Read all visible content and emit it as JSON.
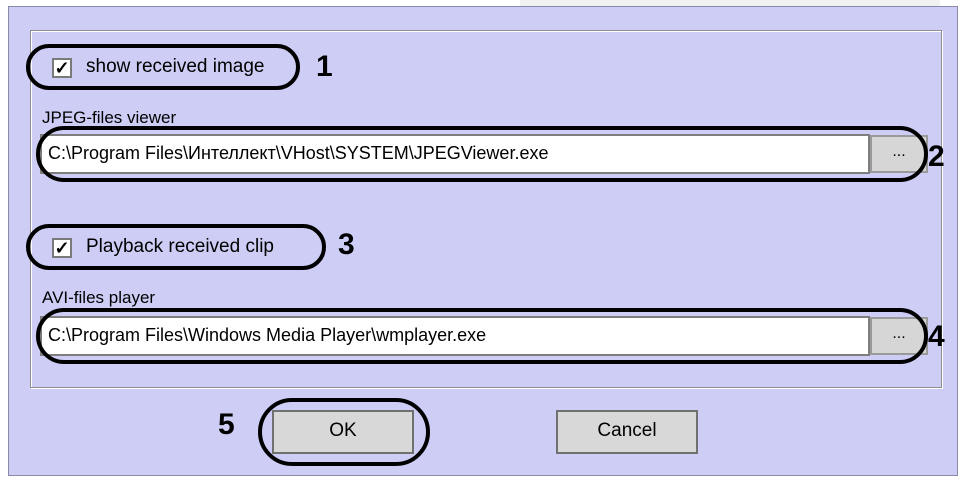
{
  "dialog": {
    "show_image": {
      "label": "show received image",
      "checked": true,
      "checkmark": "☑"
    },
    "jpeg_viewer": {
      "label": "JPEG-files viewer",
      "path": "C:\\Program Files\\Интеллект\\VHost\\SYSTEM\\JPEGViewer.exe",
      "browse_label": "..."
    },
    "playback_clip": {
      "label": "Playback received clip",
      "checked": true,
      "checkmark": "☑"
    },
    "avi_player": {
      "label": "AVI-files player",
      "path": "C:\\Program Files\\Windows Media Player\\wmplayer.exe",
      "browse_label": "..."
    },
    "ok_label": "OK",
    "cancel_label": "Cancel"
  },
  "annotations": [
    "1",
    "2",
    "3",
    "4",
    "5"
  ],
  "colors": {
    "dialog_bg": "#cdcdf5",
    "ring": "#000000"
  }
}
